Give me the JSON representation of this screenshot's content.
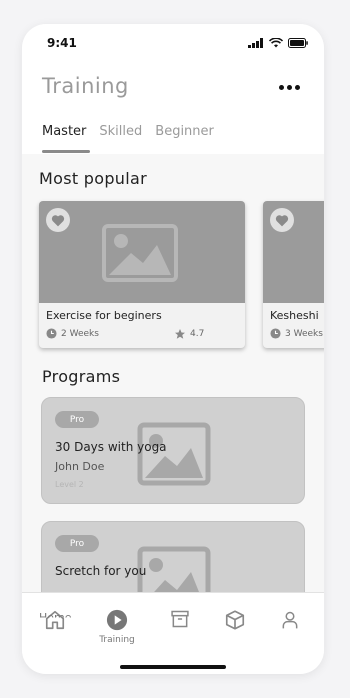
{
  "status_bar": {
    "time": "9:41"
  },
  "header": {
    "title": "Training"
  },
  "tabs": [
    {
      "label": "Master",
      "active": true
    },
    {
      "label": "Skilled",
      "active": false
    },
    {
      "label": "Beginner",
      "active": false
    }
  ],
  "most_popular": {
    "title": "Most popular",
    "cards": [
      {
        "title": "Exercise for beginers",
        "duration": "2 Weeks",
        "rating": "4.7"
      },
      {
        "title": "Kesheshi",
        "duration": "3 Weeks"
      }
    ]
  },
  "programs": {
    "title": "Programs",
    "items": [
      {
        "badge": "Pro",
        "title": "30 Days with yoga",
        "author": "John Doe",
        "level": "Level 2"
      },
      {
        "badge": "Pro",
        "title": "Scretch for you"
      }
    ]
  },
  "bottom_nav": {
    "items": [
      {
        "icon": "home-icon",
        "label": "Home",
        "active": false
      },
      {
        "icon": "play-circle-icon",
        "label": "Training",
        "active": true
      },
      {
        "icon": "archive-icon",
        "label": "",
        "active": false
      },
      {
        "icon": "box-icon",
        "label": "",
        "active": false
      },
      {
        "icon": "user-icon",
        "label": "",
        "active": false
      }
    ]
  },
  "colors": {
    "accent": "#8a8a8a",
    "card_image": "#9b9b9b",
    "program_card": "#d0d0d0"
  }
}
